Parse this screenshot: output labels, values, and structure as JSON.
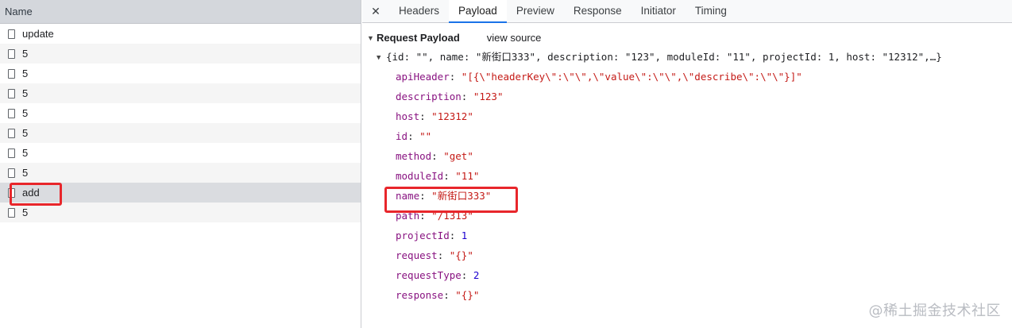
{
  "left": {
    "header": "Name",
    "rows": [
      "update",
      "5",
      "5",
      "5",
      "5",
      "5",
      "5",
      "5",
      "add",
      "5"
    ],
    "selected_index": 8
  },
  "tabs": {
    "close_icon": "close-icon",
    "items": [
      "Headers",
      "Payload",
      "Preview",
      "Response",
      "Initiator",
      "Timing"
    ],
    "active": "Payload"
  },
  "payload": {
    "title": "Request Payload",
    "view_source": "view source",
    "summary": "{id: \"\", name: \"新街口333\", description: \"123\", moduleId: \"11\", projectId: 1, host: \"12312\",…}",
    "props": [
      {
        "key": "apiHeader",
        "value": "\"[{\\\"headerKey\\\":\\\"\\\",\\\"value\\\":\\\"\\\",\\\"describe\\\":\\\"\\\"}]\"",
        "type": "string"
      },
      {
        "key": "description",
        "value": "\"123\"",
        "type": "string"
      },
      {
        "key": "host",
        "value": "\"12312\"",
        "type": "string"
      },
      {
        "key": "id",
        "value": "\"\"",
        "type": "string"
      },
      {
        "key": "method",
        "value": "\"get\"",
        "type": "string"
      },
      {
        "key": "moduleId",
        "value": "\"11\"",
        "type": "string"
      },
      {
        "key": "name",
        "value": "\"新街口333\"",
        "type": "string"
      },
      {
        "key": "path",
        "value": "\"/1313\"",
        "type": "string"
      },
      {
        "key": "projectId",
        "value": "1",
        "type": "number"
      },
      {
        "key": "request",
        "value": "\"{}\"",
        "type": "string"
      },
      {
        "key": "requestType",
        "value": "2",
        "type": "number"
      },
      {
        "key": "response",
        "value": "\"{}\"",
        "type": "string"
      }
    ]
  },
  "watermark": "@稀土掘金技术社区",
  "colors": {
    "highlight": "#e8262b",
    "accent": "#1a73e8",
    "key": "#881280",
    "string": "#c41a16",
    "number": "#1c00cf"
  }
}
